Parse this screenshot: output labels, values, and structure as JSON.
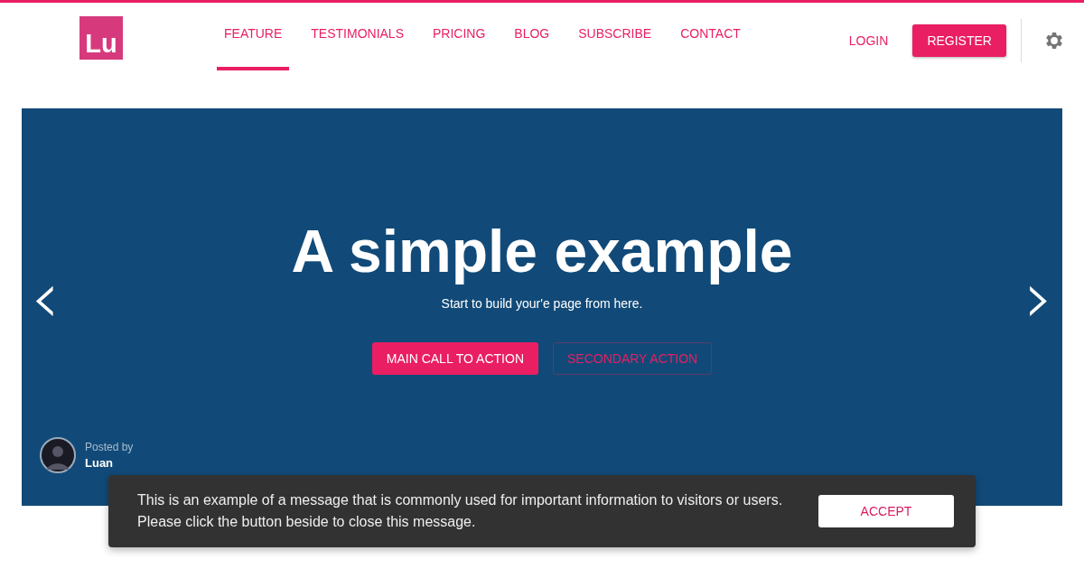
{
  "logo": {
    "text": "Lu"
  },
  "nav": [
    {
      "label": "FEATURE",
      "selected": true
    },
    {
      "label": "TESTIMONIALS",
      "selected": false
    },
    {
      "label": "PRICING",
      "selected": false
    },
    {
      "label": "BLOG",
      "selected": false
    },
    {
      "label": "SUBSCRIBE",
      "selected": false
    },
    {
      "label": "CONTACT",
      "selected": false
    }
  ],
  "login": "LOGIN",
  "register": "REGISTER",
  "hero": {
    "title": "A simple example",
    "subtitle": "Start to build your'e page from here.",
    "primary_action": "MAIN CALL TO ACTION",
    "secondary_action": "SECONDARY ACTION",
    "prev": "‹",
    "next": "›",
    "posted_by": "Posted by",
    "author": "Luan"
  },
  "cookie": {
    "message": "This is an example of a message that is commonly used for important information to visitors or users. Please click the button beside to close this message.",
    "accept": "ACCEPT"
  }
}
